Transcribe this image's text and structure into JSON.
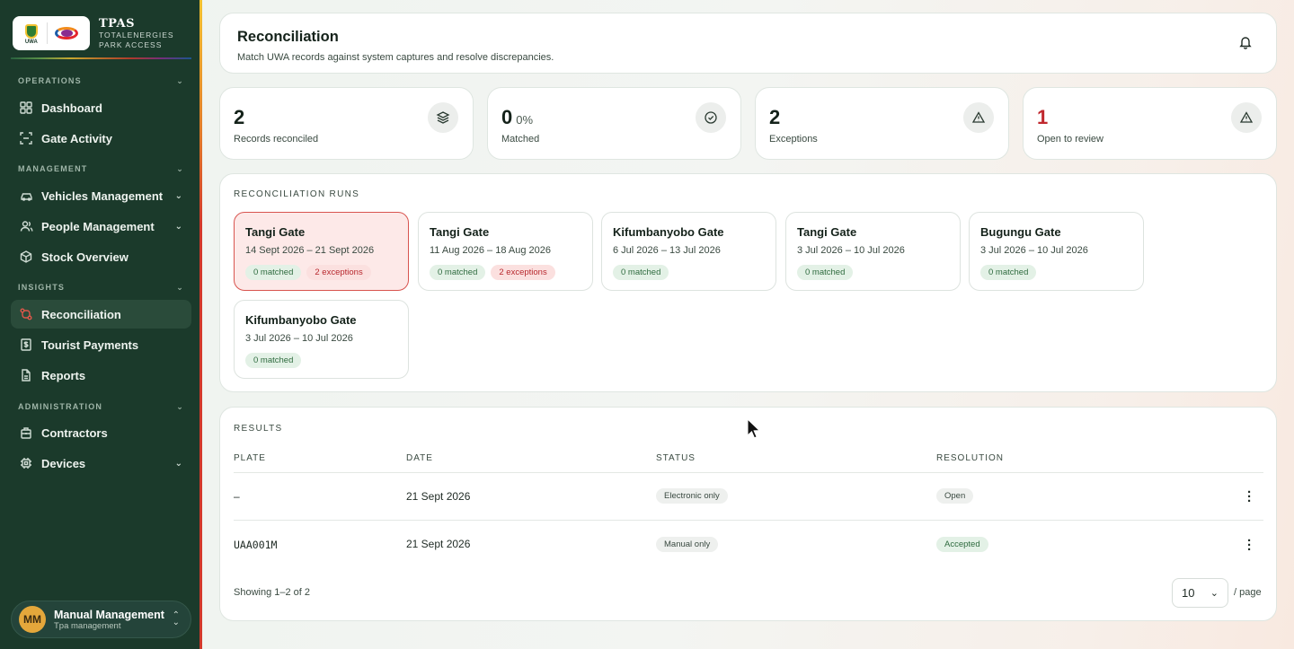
{
  "brand": {
    "name": "TPAS",
    "sub1": "TOTALENERGIES",
    "sub2": "PARK ACCESS",
    "uwa_logo_text": "UWA"
  },
  "sidebar": {
    "sections": [
      {
        "label": "OPERATIONS"
      },
      {
        "label": "MANAGEMENT"
      },
      {
        "label": "INSIGHTS"
      },
      {
        "label": "ADMINISTRATION"
      }
    ],
    "items": [
      {
        "label": "Dashboard",
        "icon": "grid-icon"
      },
      {
        "label": "Gate Activity",
        "icon": "scan-icon"
      },
      {
        "label": "Vehicles Management",
        "icon": "car-icon"
      },
      {
        "label": "People Management",
        "icon": "users-icon"
      },
      {
        "label": "Stock Overview",
        "icon": "box-icon"
      },
      {
        "label": "Reconciliation",
        "icon": "git-compare-icon",
        "active": true
      },
      {
        "label": "Tourist Payments",
        "icon": "receipt-icon"
      },
      {
        "label": "Reports",
        "icon": "file-icon"
      },
      {
        "label": "Contractors",
        "icon": "building-icon"
      },
      {
        "label": "Devices",
        "icon": "chip-icon"
      }
    ],
    "user": {
      "initials": "MM",
      "name": "Manual Management",
      "role": "Tpa management"
    }
  },
  "header": {
    "title": "Reconciliation",
    "subtitle": "Match UWA records against system captures and resolve discrepancies."
  },
  "stats": [
    {
      "value": "2",
      "unit": "",
      "label": "Records reconciled",
      "icon": "layers-icon"
    },
    {
      "value": "0",
      "unit": "0%",
      "label": "Matched",
      "icon": "check-circle-icon"
    },
    {
      "value": "2",
      "unit": "",
      "label": "Exceptions",
      "icon": "alert-triangle-icon"
    },
    {
      "value": "1",
      "unit": "",
      "label": "Open to review",
      "icon": "alert-triangle-icon",
      "color": "#c0282e"
    }
  ],
  "runs": {
    "label": "RECONCILIATION RUNS",
    "items": [
      {
        "gate": "Tangi Gate",
        "dates": "14 Sept 2026 – 21 Sept 2026",
        "matched": "0 matched",
        "exceptions": "2 exceptions",
        "selected": true
      },
      {
        "gate": "Tangi Gate",
        "dates": "11 Aug 2026 – 18 Aug 2026",
        "matched": "0 matched",
        "exceptions": "2 exceptions"
      },
      {
        "gate": "Kifumbanyobo Gate",
        "dates": "6 Jul 2026 – 13 Jul 2026",
        "matched": "0 matched"
      },
      {
        "gate": "Tangi Gate",
        "dates": "3 Jul 2026 – 10 Jul 2026",
        "matched": "0 matched"
      },
      {
        "gate": "Bugungu Gate",
        "dates": "3 Jul 2026 – 10 Jul 2026",
        "matched": "0 matched"
      },
      {
        "gate": "Kifumbanyobo Gate",
        "dates": "3 Jul 2026 – 10 Jul 2026",
        "matched": "0 matched"
      }
    ]
  },
  "results": {
    "label": "RESULTS",
    "columns": [
      "PLATE",
      "DATE",
      "STATUS",
      "RESOLUTION"
    ],
    "rows": [
      {
        "plate": "–",
        "date": "21 Sept 2026",
        "status": "Electronic only",
        "resolution": "Open"
      },
      {
        "plate": "UAA001M",
        "date": "21 Sept 2026",
        "status": "Manual only",
        "resolution": "Accepted"
      }
    ],
    "showing": "Showing 1–2 of 2",
    "page_size": "10",
    "per_page": "/ page"
  },
  "colors": {
    "sidebar": "#1b3a2b",
    "accent_red": "#c0282e",
    "chip_green": "#e3f1e6",
    "chip_red": "#fbe0df"
  }
}
